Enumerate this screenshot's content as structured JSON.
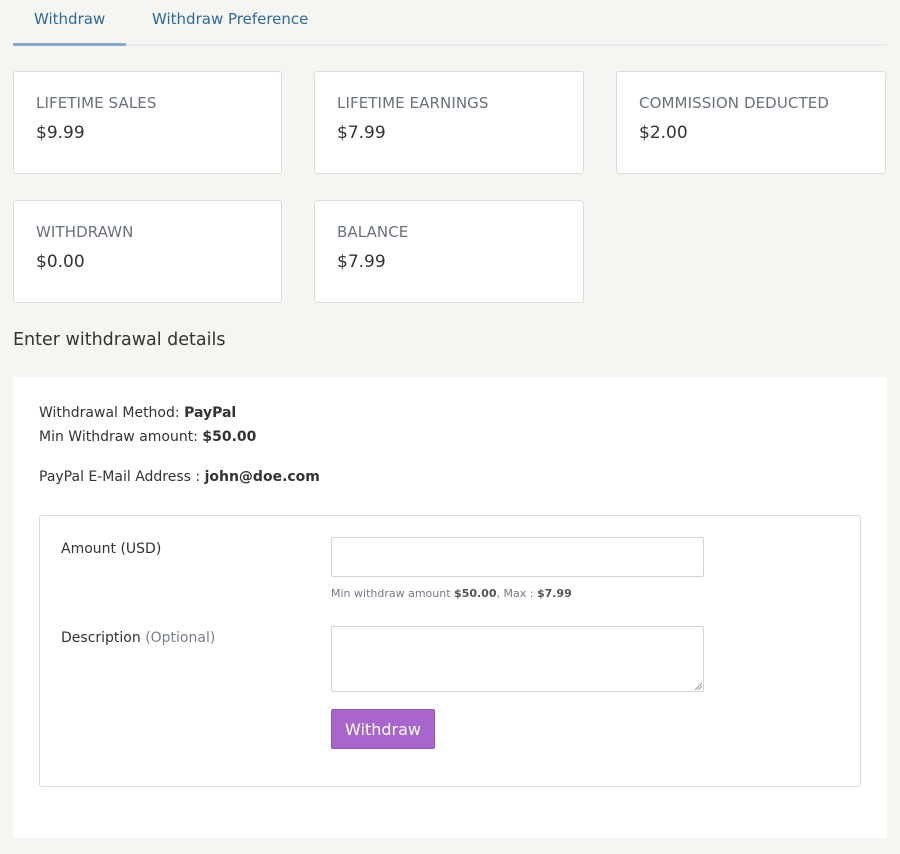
{
  "tabs": [
    {
      "label": "Withdraw",
      "active": true
    },
    {
      "label": "Withdraw Preference",
      "active": false
    }
  ],
  "stats": [
    {
      "label": "LIFETIME SALES",
      "value": "$9.99"
    },
    {
      "label": "LIFETIME EARNINGS",
      "value": "$7.99"
    },
    {
      "label": "COMMISSION DEDUCTED",
      "value": "$2.00"
    },
    {
      "label": "WITHDRAWN",
      "value": "$0.00"
    },
    {
      "label": "BALANCE",
      "value": "$7.99"
    }
  ],
  "section_title": "Enter withdrawal details",
  "details": {
    "method_label": "Withdrawal Method:",
    "method_value": "PayPal",
    "min_label": "Min Withdraw amount:",
    "min_value": "$50.00",
    "email_label": "PayPal E-Mail Address :",
    "email_value": "john@doe.com"
  },
  "form": {
    "amount_label": "Amount (USD)",
    "amount_value": "",
    "hint_prefix": "Min withdraw amount",
    "hint_min": "$50.00",
    "hint_mid": ", Max :",
    "hint_max": "$7.99",
    "description_label": "Description",
    "description_optional": "(Optional)",
    "description_value": "",
    "submit_label": "Withdraw"
  },
  "colors": {
    "accent": "#a865cc",
    "tab_text": "#2f6a9b",
    "page_bg": "#f5f5f1"
  }
}
